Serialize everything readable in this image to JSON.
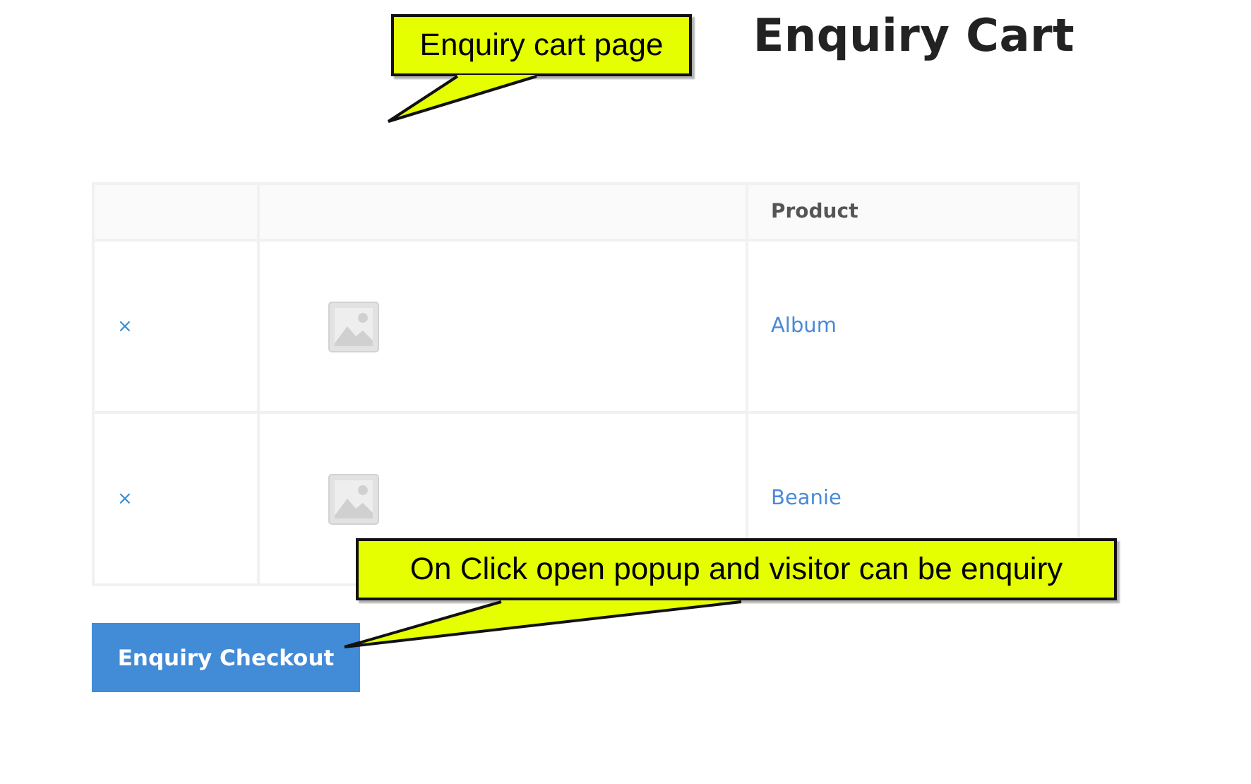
{
  "page": {
    "title": "Enquiry Cart"
  },
  "table": {
    "columns": [
      {
        "label": "Product"
      }
    ],
    "rows": [
      {
        "remove": "×",
        "product": "Album"
      },
      {
        "remove": "×",
        "product": "Beanie"
      }
    ]
  },
  "checkout_button": {
    "label": "Enquiry Checkout"
  },
  "annotations": [
    {
      "text": "Enquiry cart page"
    },
    {
      "text": "On Click open popup and visitor can be enquiry"
    }
  ]
}
